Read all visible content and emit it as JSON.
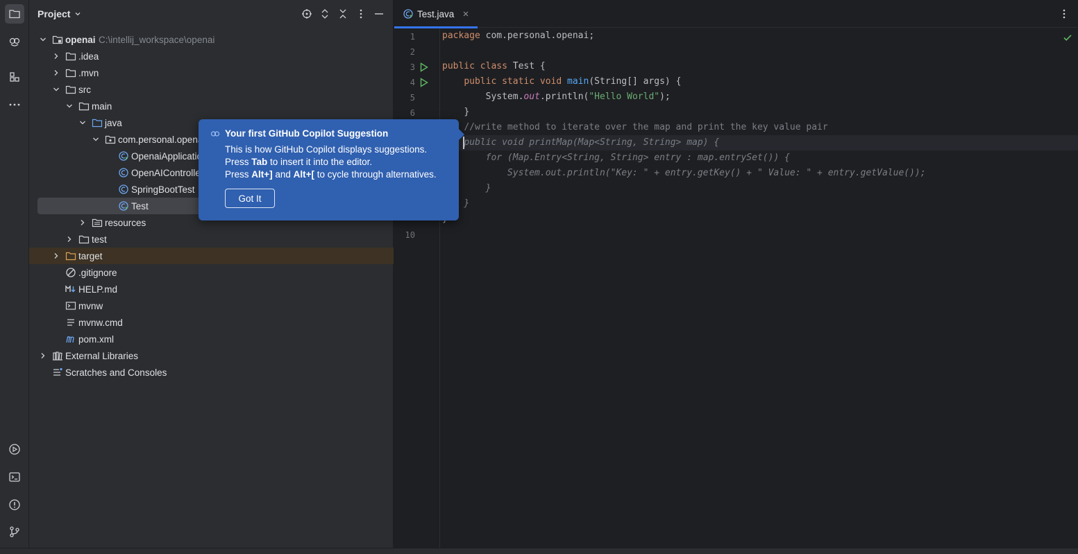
{
  "project_panel": {
    "title": "Project",
    "tree": [
      {
        "label": "openai",
        "path": "C:\\intellij_workspace\\openai"
      },
      {
        "label": ".idea"
      },
      {
        "label": ".mvn"
      },
      {
        "label": "src"
      },
      {
        "label": "main"
      },
      {
        "label": "java"
      },
      {
        "label": "com.personal.openai"
      },
      {
        "label": "OpenaiApplication"
      },
      {
        "label": "OpenAIController"
      },
      {
        "label": "SpringBootTest"
      },
      {
        "label": "Test"
      },
      {
        "label": "resources"
      },
      {
        "label": "test"
      },
      {
        "label": "target"
      },
      {
        "label": ".gitignore"
      },
      {
        "label": "HELP.md"
      },
      {
        "label": "mvnw"
      },
      {
        "label": "mvnw.cmd"
      },
      {
        "label": "pom.xml"
      },
      {
        "label": "External Libraries"
      },
      {
        "label": "Scratches and Consoles"
      }
    ]
  },
  "editor": {
    "tab_label": "Test.java",
    "line_numbers": [
      "1",
      "2",
      "3",
      "4",
      "5",
      "6",
      "10"
    ],
    "code": {
      "l1_kw": "package",
      "l1_rest": " com.personal.openai;",
      "l3_kw": "public class",
      "l3_rest": " Test {",
      "l4_kw": "public static void",
      "l4_fn": "main",
      "l4_rest": "(String[] args) {",
      "l5_a": "System.",
      "l5_out": "out",
      "l5_b": ".println(",
      "l5_str": "\"Hello World\"",
      "l5_c": ");",
      "l6": "}",
      "comment": "//write method to iterate over the map and print the key value pair",
      "ghost1": "public void printMap(Map<String, String> map) {",
      "ghost2": "for (Map.Entry<String, String> entry : map.entrySet()) {",
      "ghost3": "System.out.println(\"Key: \" + entry.getKey() + \" Value: \" + entry.getValue());",
      "ghost4": "}",
      "ghost5": "}",
      "close": "}"
    }
  },
  "copilot_popup": {
    "title": "Your first GitHub Copilot Suggestion",
    "line1": "This is how GitHub Copilot displays suggestions.",
    "line2_a": "Press ",
    "line2_key": "Tab",
    "line2_b": " to insert it into the editor.",
    "line3_a": "Press ",
    "line3_key1": "Alt+]",
    "line3_b": " and ",
    "line3_key2": "Alt+[",
    "line3_c": " to cycle through alternatives.",
    "button": "Got It"
  },
  "colors": {
    "accent": "#3574f0",
    "popup_bg": "#3060b0"
  }
}
